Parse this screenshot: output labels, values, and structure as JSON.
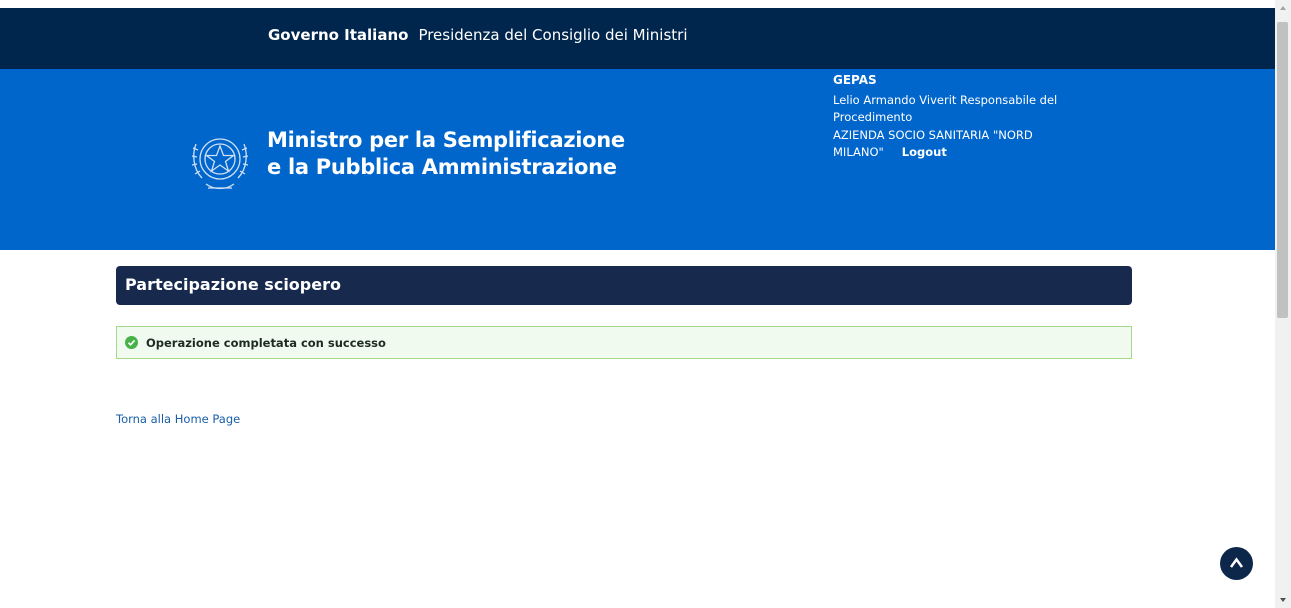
{
  "topbar": {
    "government": "Governo Italiano",
    "presidency": "Presidenza del Consiglio dei Ministri"
  },
  "header": {
    "ministry_line1": "Ministro per la Semplificazione",
    "ministry_line2": "e la Pubblica Amministrazione",
    "emblem_icon": "italian-republic-emblem-icon",
    "app_name": "GEPAS",
    "user_name_line1": "Lelio Armando Viverit Responsabile del",
    "user_name_line2": "Procedimento",
    "org_line1": "AZIENDA SOCIO SANITARIA \"NORD",
    "org_line2": "MILANO\"",
    "logout_label": "Logout"
  },
  "main": {
    "title": "Partecipazione sciopero",
    "success_message": "Operazione completata con successo",
    "home_link": "Torna alla Home Page"
  },
  "colors": {
    "topbar": "#00264d",
    "header": "#0066cc",
    "title_bar": "#17294d",
    "success_bg": "#f1faef",
    "success_border": "#a6d98c",
    "success_icon": "#47b248",
    "link": "#1a5ea8"
  },
  "icons": {
    "success": "check-circle-icon",
    "scroll_top": "chevron-up-icon"
  }
}
